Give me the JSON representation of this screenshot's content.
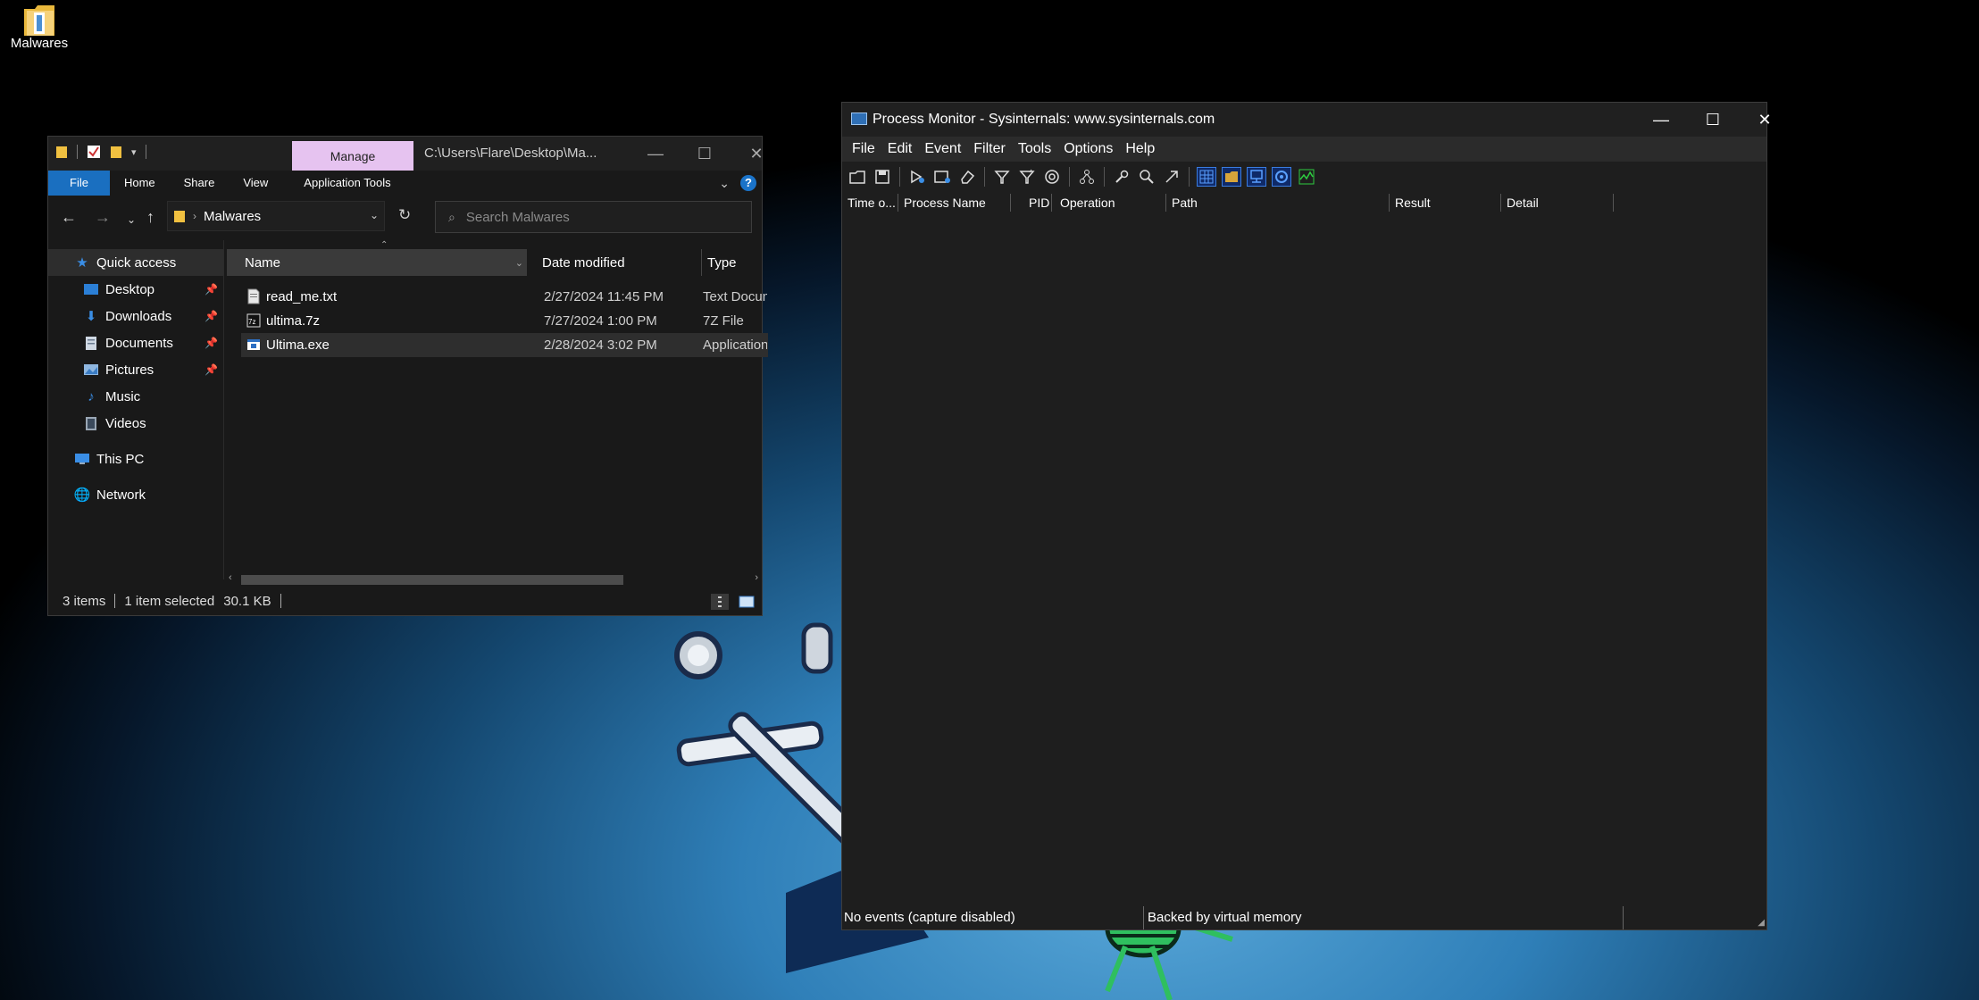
{
  "desktop": {
    "icons": [
      {
        "label": "Malwares",
        "icon": "folder-icon"
      }
    ]
  },
  "explorer": {
    "title_path": "C:\\Users\\Flare\\Desktop\\Ma...",
    "manage_tab": "Manage",
    "ribbon_tabs": [
      "File",
      "Home",
      "Share",
      "View",
      "Application Tools"
    ],
    "address": {
      "crumb": "Malwares"
    },
    "search": {
      "placeholder": "Search Malwares"
    },
    "nav": [
      {
        "label": "Quick access",
        "icon": "star-icon",
        "pinned": false,
        "selected": true
      },
      {
        "label": "Desktop",
        "icon": "desktop-icon",
        "pinned": true
      },
      {
        "label": "Downloads",
        "icon": "download-icon",
        "pinned": true
      },
      {
        "label": "Documents",
        "icon": "document-icon",
        "pinned": true
      },
      {
        "label": "Pictures",
        "icon": "picture-icon",
        "pinned": true
      },
      {
        "label": "Music",
        "icon": "music-icon",
        "pinned": false
      },
      {
        "label": "Videos",
        "icon": "video-icon",
        "pinned": false
      },
      {
        "label": "This PC",
        "icon": "computer-icon",
        "pinned": false
      },
      {
        "label": "Network",
        "icon": "network-icon",
        "pinned": false
      }
    ],
    "columns": {
      "name": "Name",
      "date": "Date modified",
      "type": "Type"
    },
    "files": [
      {
        "name": "read_me.txt",
        "date": "2/27/2024 11:45 PM",
        "type": "Text Document",
        "icon": "text-file-icon"
      },
      {
        "name": "ultima.7z",
        "date": "7/27/2024 1:00 PM",
        "type": "7Z File",
        "icon": "archive-icon"
      },
      {
        "name": "Ultima.exe",
        "date": "2/28/2024 3:02 PM",
        "type": "Application",
        "icon": "exe-icon",
        "selected": true
      }
    ],
    "status": {
      "count": "3 items",
      "selection": "1 item selected",
      "size": "30.1 KB"
    }
  },
  "procmon": {
    "title": "Process Monitor - Sysinternals: www.sysinternals.com",
    "menu": [
      "File",
      "Edit",
      "Event",
      "Filter",
      "Tools",
      "Options",
      "Help"
    ],
    "columns": [
      "Time o...",
      "Process Name",
      "PID",
      "Operation",
      "Path",
      "Result",
      "Detail"
    ],
    "status": {
      "events": "No events (capture disabled)",
      "backing": "Backed by virtual memory"
    }
  },
  "colors": {
    "ribbon_file": "#1a6fc0",
    "manage_tab": "#e6c3f0",
    "toolbar_active": "#0f2a68"
  }
}
